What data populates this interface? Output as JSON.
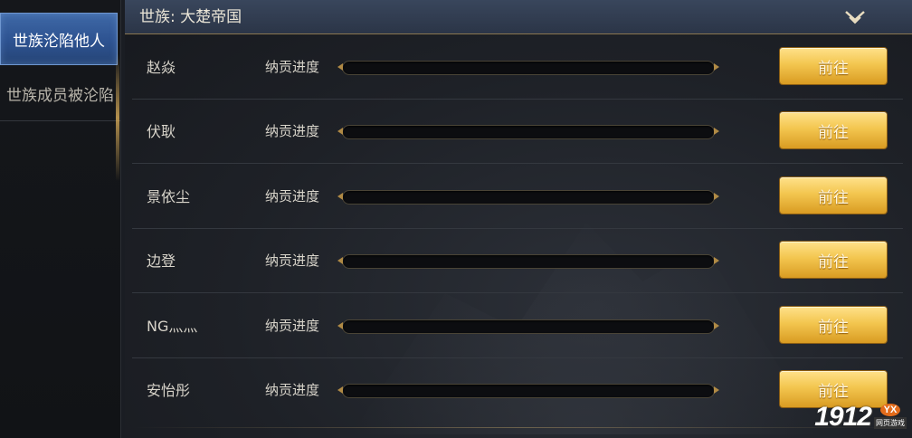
{
  "sidebar": {
    "tabs": [
      {
        "label": "世族沦陷他人",
        "active": true
      },
      {
        "label": "世族成员被沦陷",
        "active": false
      }
    ]
  },
  "header": {
    "title": "世族: 大楚帝国",
    "toggle_icon": "chevron-down-icon"
  },
  "rows": [
    {
      "name": "赵焱",
      "label": "纳贡进度",
      "progress": 0,
      "button": "前往"
    },
    {
      "name": "伏耿",
      "label": "纳贡进度",
      "progress": 0,
      "button": "前往"
    },
    {
      "name": "景依尘",
      "label": "纳贡进度",
      "progress": 0,
      "button": "前往"
    },
    {
      "name": "边登",
      "label": "纳贡进度",
      "progress": 0,
      "button": "前往"
    },
    {
      "name": "NG灬灬",
      "label": "纳贡进度",
      "progress": 0,
      "button": "前往"
    },
    {
      "name": "安怡彤",
      "label": "纳贡进度",
      "progress": 0,
      "button": "前往"
    }
  ],
  "watermark": {
    "number": "1912",
    "badge": "YX",
    "subtitle": "网页游戏"
  },
  "colors": {
    "accent_gold": "#f3c64f",
    "active_tab": "#2d5290",
    "background": "#1e2127"
  }
}
